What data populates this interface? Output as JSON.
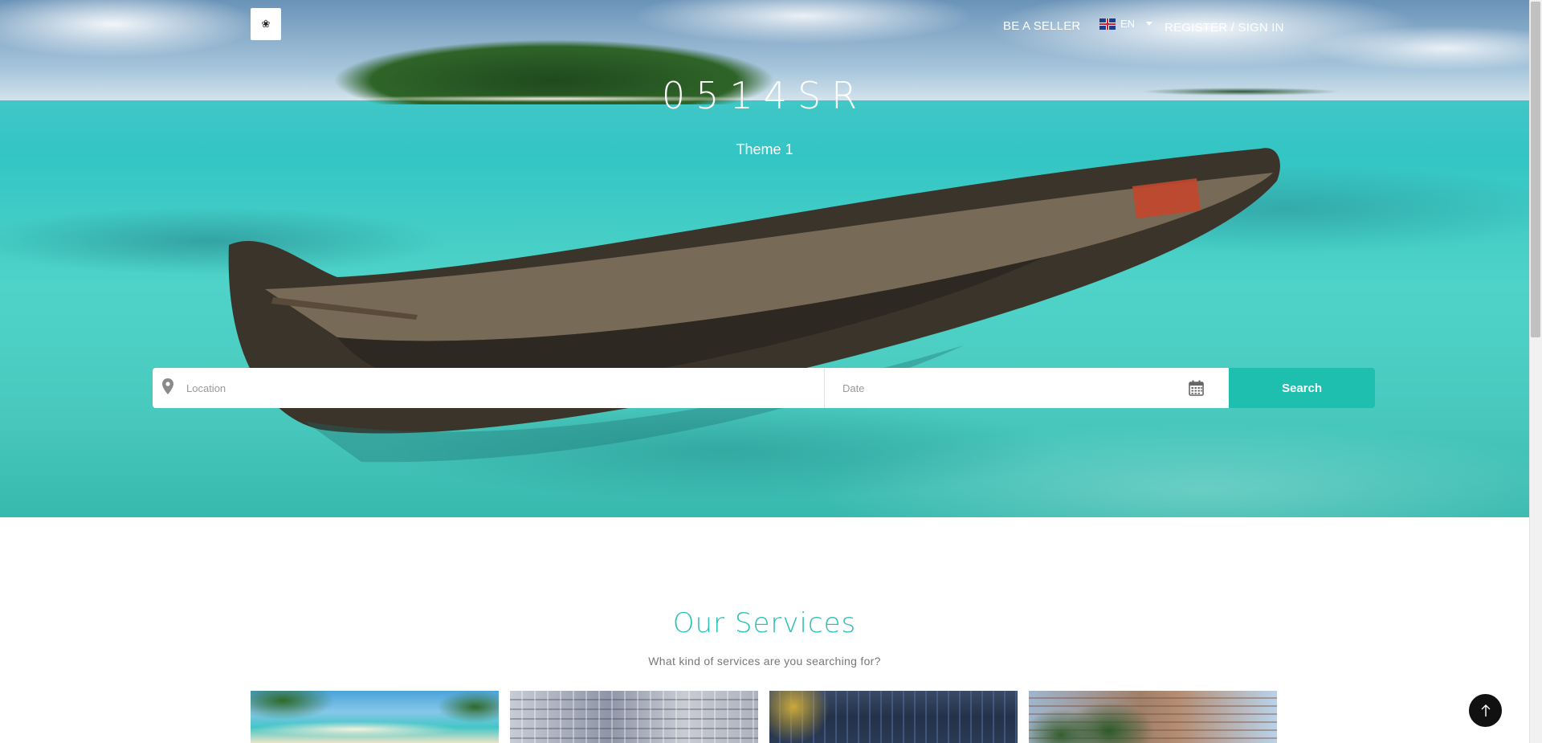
{
  "header": {
    "logo_alt": "logo",
    "be_seller": "BE A SELLER",
    "language": "EN",
    "register": "REGISTER / SIGN IN"
  },
  "hero": {
    "title": "0514SR",
    "subtitle": "Theme 1"
  },
  "search": {
    "location_placeholder": "Location",
    "date_placeholder": "Date",
    "button": "Search"
  },
  "services": {
    "title": "Our Services",
    "subtitle": "What kind of services are you searching for?"
  },
  "colors": {
    "accent": "#1fbfb0",
    "title_accent": "#2cc1b6"
  },
  "icons": {
    "location": "map-pin-icon",
    "date": "calendar-icon",
    "back_to_top": "arrow-up-icon"
  }
}
